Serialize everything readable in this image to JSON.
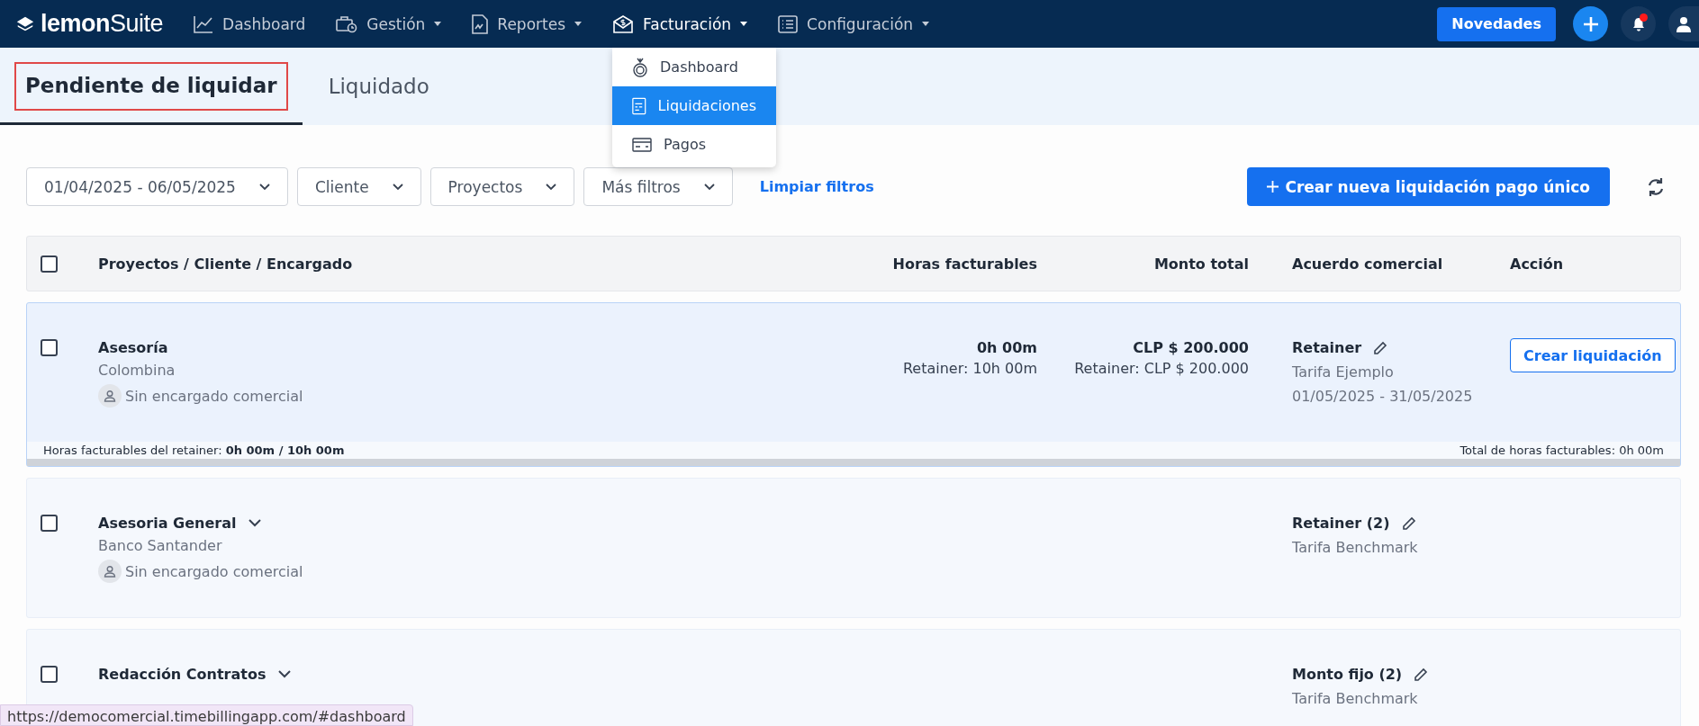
{
  "nav": {
    "brand": "**lemon**Suite",
    "items": [
      {
        "label": "Dashboard",
        "kind": "chart",
        "caret": false,
        "selected": false
      },
      {
        "label": "Gestión",
        "kind": "briefcase",
        "caret": true,
        "selected": false
      },
      {
        "label": "Reportes",
        "kind": "document",
        "caret": true,
        "selected": false
      },
      {
        "label": "Facturación",
        "kind": "envelope",
        "caret": true,
        "selected": true
      },
      {
        "label": "Configuración",
        "kind": "list",
        "caret": true,
        "selected": false
      }
    ],
    "news_button": "Novedades",
    "notifications": {
      "unread": true
    }
  },
  "dropdown": [
    {
      "label": "Dashboard",
      "kind": "money-bag",
      "selected": false
    },
    {
      "label": "Liquidaciones",
      "kind": "document",
      "selected": true
    },
    {
      "label": "Pagos",
      "kind": "card",
      "selected": false
    }
  ],
  "tabs": [
    {
      "label": "Pendiente de liquidar",
      "selected": true
    },
    {
      "label": "Liquidado",
      "selected": false
    }
  ],
  "filters": [
    {
      "label": "01/04/2025 - 06/05/2025"
    },
    {
      "label": "Cliente"
    },
    {
      "label": "Proyectos"
    },
    {
      "label": "Más filtros"
    }
  ],
  "clear_filters": "Limpiar filtros",
  "create_button": "Crear nueva liquidación pago único",
  "table": {
    "select_all": {
      "checked": false
    },
    "columns": [
      "Proyectos / Cliente / Encargado",
      "Horas facturables",
      "Monto total",
      "Acuerdo comercial",
      "Acción"
    ],
    "rows": [
      {
        "selected": true,
        "checked": false,
        "project": "Asesoría",
        "expandable": false,
        "client": "Colombina",
        "manager": "Sin encargado comercial",
        "hours": "0h 00m",
        "hours_sub": "Retainer: 10h 00m",
        "amount": "CLP $ 200.000",
        "amount_sub": "Retainer: CLP $ 200.000",
        "agreement": "Retainer",
        "tariff": "Tarifa Ejemplo",
        "period": "01/05/2025 - 31/05/2025",
        "action": "Crear liquidación",
        "footer_left": "Horas facturables del retainer: **0h 00m / 10h 00m**",
        "footer_right": "Total de horas facturables: 0h 00m"
      },
      {
        "selected": false,
        "checked": false,
        "project": "Asesoria General",
        "expandable": true,
        "client": "Banco Santander",
        "manager": "Sin encargado comercial",
        "agreement": "Retainer (2)",
        "tariff": "Tarifa Benchmark"
      },
      {
        "selected": false,
        "checked": false,
        "project": "Redacción Contratos",
        "expandable": true,
        "agreement": "Monto fijo (2)",
        "tariff": "Tarifa Benchmark"
      }
    ]
  },
  "status_url": "https://democomercial.timebillingapp.com/#dashboard"
}
